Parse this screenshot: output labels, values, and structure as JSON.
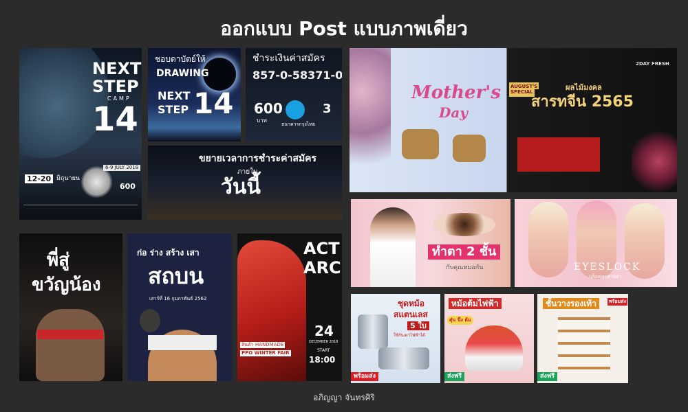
{
  "header": {
    "title": "ออกแบบ Post แบบภาพเดี่ยว"
  },
  "posters": {
    "next_step_camp": {
      "title_line1": "NEXT",
      "title_line2": "STEP",
      "sub": "CAMP",
      "number": "14",
      "date": "6-9 JULY 2018",
      "date_badge": "12-20",
      "month": "มิถุนายน",
      "price": "600"
    },
    "drawing": {
      "line1": "ชอบดาบัตย์ให้",
      "line2": "DRAWING",
      "line3": "NEXT",
      "line4": "STEP",
      "number": "14"
    },
    "payment": {
      "title": "ชำระเงินค่าสมัคร",
      "account": "857-0-58371-0",
      "price": "600",
      "unit": "บาท",
      "bank": "ธนาคารกรุงไทย",
      "days": "3"
    },
    "extend": {
      "line1": "ขยายเวลาการชำระค่าสมัคร",
      "line2": "ภายใน",
      "line3": "วันนี้"
    },
    "brother": {
      "top": "พี่สู่",
      "bottom": "ขวัญน้อง"
    },
    "protest": {
      "line1": "ก่อ ร่าง สร้าง เสา",
      "big": "สถบน",
      "date": "เสาร์ที่ 16 กุมภาพันธ์ 2562"
    },
    "act_arch": {
      "title1": "ACT",
      "title2": "ARCH",
      "day": "24",
      "month": "DECEMBER 2018",
      "start": "START",
      "time": "18:00",
      "fair": "PPO WINTER FAIR",
      "handmade": "สินค้า HANDMADE"
    },
    "mothers_day": {
      "title": "Mother's",
      "title2": "Day",
      "badge1": "AUGUST'S",
      "badge2": "SPECIAL",
      "subtitle": "ผลไม้มงคล",
      "headline": "สารทจีน 2565",
      "brand": "2DAY FRESH"
    },
    "eye_clinic": {
      "headline": "ทำตา 2 ชั้น",
      "sub": "กับคุณหมอกัน"
    },
    "eyeslock": {
      "brand": "EYESLOCK",
      "sub": "บล็อคทุกสายตา"
    },
    "pot_set": {
      "headline": "ชุดหม้อ",
      "line2": "สแตนเลส",
      "line3": "5 ใบ",
      "line4": "ใช้กันเตาไฟฟ้าได้",
      "badge": "พร้อมส่ง"
    },
    "hotpot": {
      "headline": "หม้อต้มไฟฟ้า",
      "bubble": "ตุ๋น นึ่ง ต้ม",
      "badge": "ส่งฟรี"
    },
    "shoe_rack": {
      "headline": "ชั้นวางรองเท้า",
      "badge": "พร้อมส่ง",
      "badge2": "ส่งฟรี"
    }
  },
  "footer": {
    "credit": "อภิญญา จันทรศิริ"
  }
}
